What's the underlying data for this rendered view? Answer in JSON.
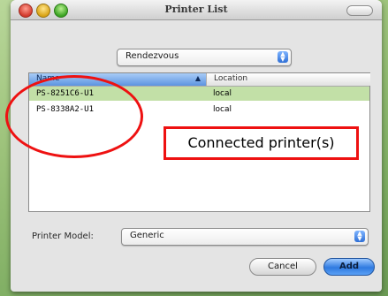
{
  "window": {
    "title": "Printer List"
  },
  "discovery": {
    "selected": "Rendezvous"
  },
  "printer_list": {
    "columns": [
      "Name",
      "Location"
    ],
    "rows": [
      {
        "name": "PS-8251C6-U1",
        "location": "local",
        "selected": true
      },
      {
        "name": "PS-8338A2-U1",
        "location": "local",
        "selected": false
      }
    ]
  },
  "printer_model": {
    "label": "Printer Model:",
    "selected": "Generic"
  },
  "buttons": {
    "cancel": "Cancel",
    "add": "Add"
  },
  "annotation": {
    "text": "Connected printer(s)",
    "color": "#e11111"
  },
  "icons": {
    "popup_arrows": "up-down-arrows-icon",
    "sort": "sort-ascending-icon"
  }
}
